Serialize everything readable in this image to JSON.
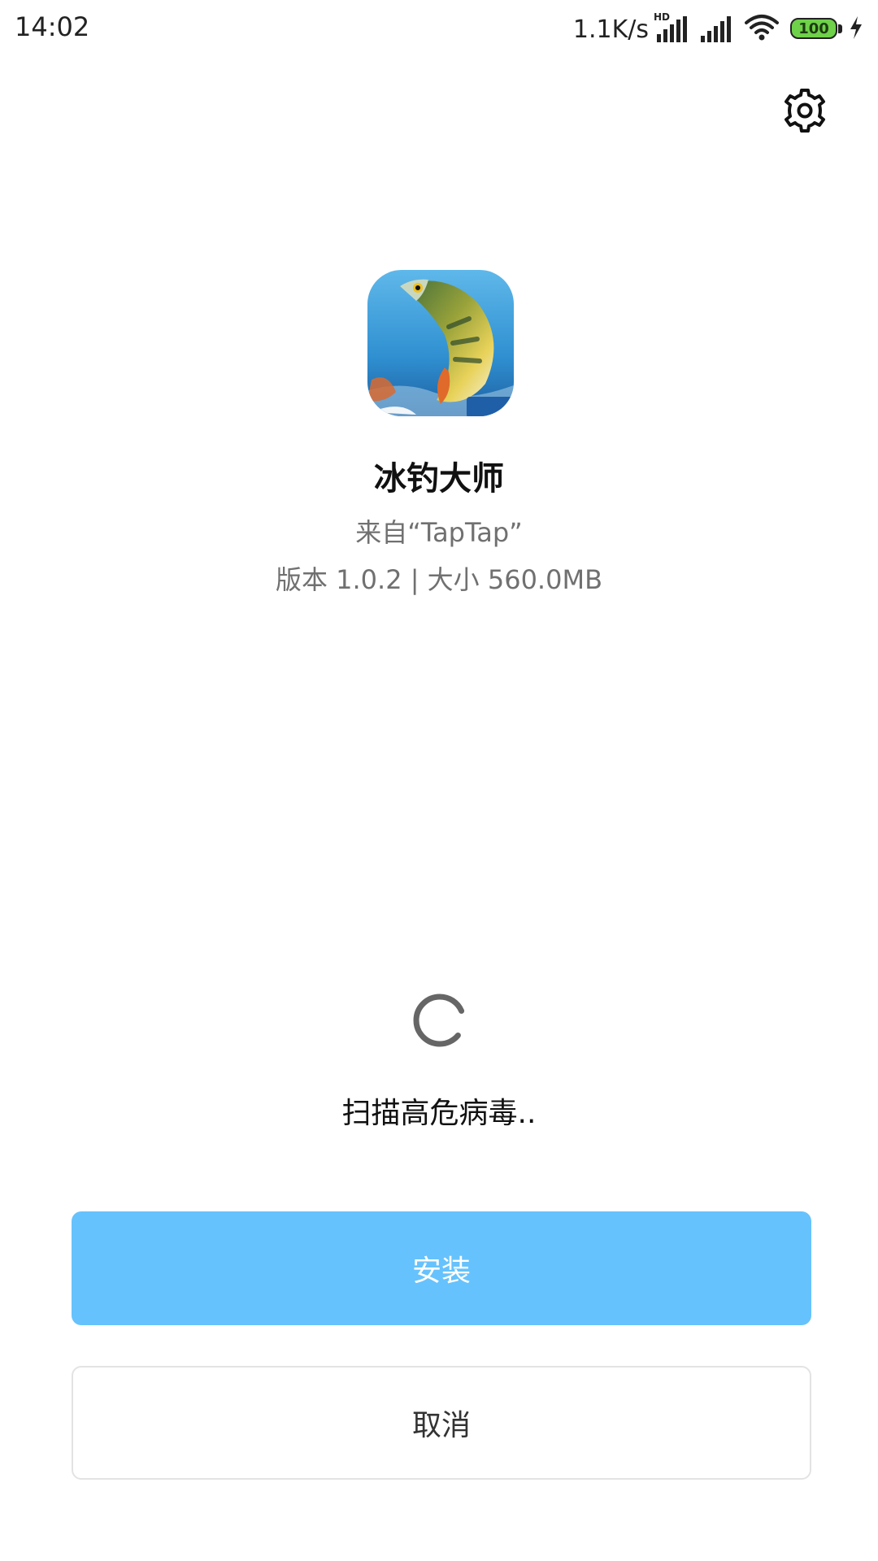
{
  "status_bar": {
    "time": "14:02",
    "net_speed": "1.1K/s",
    "signal_hd_label": "HD",
    "battery_level": "100",
    "icons": [
      "signal-hd-icon",
      "signal-icon",
      "wifi-icon",
      "battery-icon",
      "charging-icon"
    ]
  },
  "header": {
    "settings_icon": "gear-icon"
  },
  "app": {
    "name": "冰钓大师",
    "source": "来自“TapTap”",
    "meta": "版本 1.0.2 | 大小 560.0MB"
  },
  "scan": {
    "status": "扫描高危病毒.."
  },
  "actions": {
    "install_label": "安装",
    "cancel_label": "取消"
  },
  "colors": {
    "install_bg": "#66c2fc",
    "battery_fill": "#6fd14a",
    "secondary_text": "#707070"
  }
}
